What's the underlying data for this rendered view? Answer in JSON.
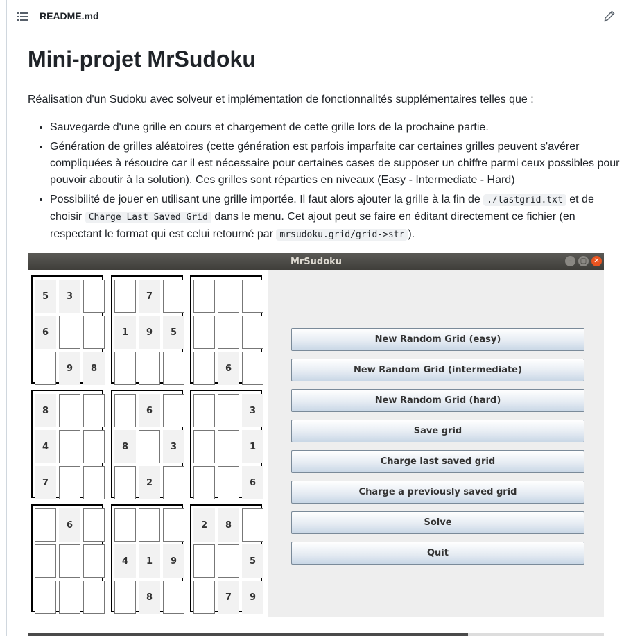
{
  "file_header": {
    "file_name": "README.md",
    "outline_icon": "list-icon",
    "edit_icon": "pencil-icon"
  },
  "readme": {
    "title": "Mini-projet MrSudoku",
    "intro": "Réalisation d'un Sudoku avec solveur et implémentation de fonctionnalités supplémentaires telles que :",
    "bullet1": "Sauvegarde d'une grille en cours et chargement de cette grille lors de la prochaine partie.",
    "bullet2": "Génération de grilles aléatoires (cette génération est parfois imparfaite car certaines grilles peuvent s'avérer compliquées à résoudre car il est nécessaire pour certaines cases de supposer un chiffre parmi ceux possibles pour pouvoir aboutir à la solution). Ces grilles sont réparties en niveaux (Easy - Intermediate - Hard)",
    "bullet3": {
      "t1": "Possibilité de jouer en utilisant une grille importée. Il faut alors ajouter la grille à la fin de ",
      "c1": "./lastgrid.txt",
      "t2": " et de choisir ",
      "c2": "Charge Last Saved Grid",
      "t3": " dans le menu. Cet ajout peut se faire en éditant directement ce fichier (en respectant le format qui est celui retourné par ",
      "c3": "mrsudoku.grid/grid->str",
      "t4": ")."
    }
  },
  "app_window": {
    "title": "MrSudoku",
    "controls": {
      "minimize": "–",
      "maximize": "▢",
      "close": "✕"
    },
    "grid": [
      [
        "5",
        "3",
        "|",
        "",
        "7",
        "",
        "",
        "",
        ""
      ],
      [
        "6",
        "",
        "",
        "1",
        "9",
        "5",
        "",
        "",
        ""
      ],
      [
        "",
        "9",
        "8",
        "",
        "",
        "",
        "",
        "6",
        ""
      ],
      [
        "8",
        "",
        "",
        "",
        "6",
        "",
        "",
        "",
        "3"
      ],
      [
        "4",
        "",
        "",
        "8",
        "",
        "3",
        "",
        "",
        "1"
      ],
      [
        "7",
        "",
        "",
        "",
        "2",
        "",
        "",
        "",
        "6"
      ],
      [
        "",
        "6",
        "",
        "",
        "",
        "",
        "2",
        "8",
        ""
      ],
      [
        "",
        "",
        "",
        "4",
        "1",
        "9",
        "",
        "",
        "5"
      ],
      [
        "",
        "",
        "",
        "",
        "8",
        "",
        "",
        "7",
        "9"
      ]
    ],
    "blank_cells": [
      [
        0,
        3
      ],
      [
        0,
        5
      ],
      [
        0,
        6
      ],
      [
        0,
        7
      ],
      [
        0,
        8
      ],
      [
        1,
        1
      ],
      [
        1,
        2
      ],
      [
        1,
        6
      ],
      [
        1,
        7
      ],
      [
        1,
        8
      ],
      [
        2,
        0
      ],
      [
        2,
        3
      ],
      [
        2,
        4
      ],
      [
        2,
        5
      ],
      [
        2,
        6
      ],
      [
        2,
        8
      ],
      [
        3,
        1
      ],
      [
        3,
        2
      ],
      [
        3,
        3
      ],
      [
        3,
        5
      ],
      [
        3,
        6
      ],
      [
        3,
        7
      ],
      [
        4,
        1
      ],
      [
        4,
        2
      ],
      [
        4,
        4
      ],
      [
        4,
        6
      ],
      [
        4,
        7
      ],
      [
        5,
        1
      ],
      [
        5,
        2
      ],
      [
        5,
        3
      ],
      [
        5,
        5
      ],
      [
        5,
        6
      ],
      [
        5,
        7
      ],
      [
        6,
        0
      ],
      [
        6,
        2
      ],
      [
        6,
        3
      ],
      [
        6,
        4
      ],
      [
        6,
        5
      ],
      [
        6,
        8
      ],
      [
        7,
        0
      ],
      [
        7,
        1
      ],
      [
        7,
        2
      ],
      [
        7,
        6
      ],
      [
        7,
        7
      ],
      [
        8,
        0
      ],
      [
        8,
        1
      ],
      [
        8,
        2
      ],
      [
        8,
        3
      ],
      [
        8,
        5
      ],
      [
        8,
        6
      ]
    ],
    "buttons": [
      "New Random Grid (easy)",
      "New Random Grid (intermediate)",
      "New Random Grid (hard)",
      "Save grid",
      "Charge last saved grid",
      "Charge a previously saved grid",
      "Solve",
      "Quit"
    ]
  }
}
